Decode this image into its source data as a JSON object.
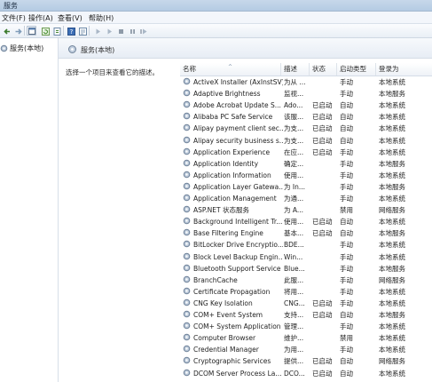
{
  "window": {
    "title": "服务"
  },
  "menu": [
    "文件(F)",
    "操作(A)",
    "查看(V)",
    "帮助(H)"
  ],
  "toolbar": {
    "buttons": [
      {
        "name": "back-icon"
      },
      {
        "name": "forward-icon"
      },
      {
        "name": "console-tree-icon"
      },
      {
        "name": "refresh-icon"
      },
      {
        "name": "export-list-icon"
      },
      {
        "name": "help-icon"
      },
      {
        "name": "properties-icon"
      },
      {
        "name": "start-service-icon"
      },
      {
        "name": "start-service-alt-icon"
      },
      {
        "name": "stop-service-icon"
      },
      {
        "name": "pause-service-icon"
      },
      {
        "name": "restart-service-icon"
      }
    ]
  },
  "tree": {
    "item_label": "服务(本地)"
  },
  "panel": {
    "header_title": "服务(本地)",
    "description": "选择一个项目来查看它的描述。"
  },
  "list": {
    "columns": [
      "名称",
      "描述",
      "状态",
      "启动类型",
      "登录为"
    ],
    "rows": [
      {
        "name": "ActiveX Installer (AxInstSV)",
        "desc": "为从 ...",
        "status": "",
        "start": "手动",
        "logon": "本地系统"
      },
      {
        "name": "Adaptive Brightness",
        "desc": "监视...",
        "status": "",
        "start": "手动",
        "logon": "本地服务"
      },
      {
        "name": "Adobe Acrobat Update S...",
        "desc": "Ado...",
        "status": "已启动",
        "start": "自动",
        "logon": "本地系统"
      },
      {
        "name": "Alibaba PC Safe Service",
        "desc": "该服...",
        "status": "已启动",
        "start": "自动",
        "logon": "本地系统"
      },
      {
        "name": "Alipay payment client sec...",
        "desc": "为支...",
        "status": "已启动",
        "start": "自动",
        "logon": "本地系统"
      },
      {
        "name": "Alipay security business s...",
        "desc": "为支...",
        "status": "已启动",
        "start": "自动",
        "logon": "本地系统"
      },
      {
        "name": "Application Experience",
        "desc": "在应...",
        "status": "已启动",
        "start": "手动",
        "logon": "本地系统"
      },
      {
        "name": "Application Identity",
        "desc": "确定...",
        "status": "",
        "start": "手动",
        "logon": "本地服务"
      },
      {
        "name": "Application Information",
        "desc": "使用...",
        "status": "",
        "start": "手动",
        "logon": "本地系统"
      },
      {
        "name": "Application Layer Gatewa...",
        "desc": "为 In...",
        "status": "",
        "start": "手动",
        "logon": "本地服务"
      },
      {
        "name": "Application Management",
        "desc": "为通...",
        "status": "",
        "start": "手动",
        "logon": "本地系统"
      },
      {
        "name": "ASP.NET 状态服务",
        "desc": "为 A...",
        "status": "",
        "start": "禁用",
        "logon": "网络服务"
      },
      {
        "name": "Background Intelligent Tr...",
        "desc": "使用...",
        "status": "已启动",
        "start": "自动",
        "logon": "本地系统"
      },
      {
        "name": "Base Filtering Engine",
        "desc": "基本...",
        "status": "已启动",
        "start": "自动",
        "logon": "本地服务"
      },
      {
        "name": "BitLocker Drive Encryptio...",
        "desc": "BDE...",
        "status": "",
        "start": "手动",
        "logon": "本地系统"
      },
      {
        "name": "Block Level Backup Engin...",
        "desc": "Win...",
        "status": "",
        "start": "手动",
        "logon": "本地系统"
      },
      {
        "name": "Bluetooth Support Service",
        "desc": "Blue...",
        "status": "",
        "start": "手动",
        "logon": "本地服务"
      },
      {
        "name": "BranchCache",
        "desc": "此服...",
        "status": "",
        "start": "手动",
        "logon": "网络服务"
      },
      {
        "name": "Certificate Propagation",
        "desc": "将用...",
        "status": "",
        "start": "手动",
        "logon": "本地系统"
      },
      {
        "name": "CNG Key Isolation",
        "desc": "CNG...",
        "status": "已启动",
        "start": "手动",
        "logon": "本地系统"
      },
      {
        "name": "COM+ Event System",
        "desc": "支持...",
        "status": "已启动",
        "start": "自动",
        "logon": "本地服务"
      },
      {
        "name": "COM+ System Application",
        "desc": "管理...",
        "status": "",
        "start": "手动",
        "logon": "本地系统"
      },
      {
        "name": "Computer Browser",
        "desc": "维护...",
        "status": "",
        "start": "禁用",
        "logon": "本地系统"
      },
      {
        "name": "Credential Manager",
        "desc": "为用...",
        "status": "",
        "start": "手动",
        "logon": "本地系统"
      },
      {
        "name": "Cryptographic Services",
        "desc": "提供...",
        "status": "已启动",
        "start": "自动",
        "logon": "网络服务"
      },
      {
        "name": "DCOM Server Process La...",
        "desc": "DCO...",
        "status": "已启动",
        "start": "自动",
        "logon": "本地系统"
      }
    ]
  }
}
